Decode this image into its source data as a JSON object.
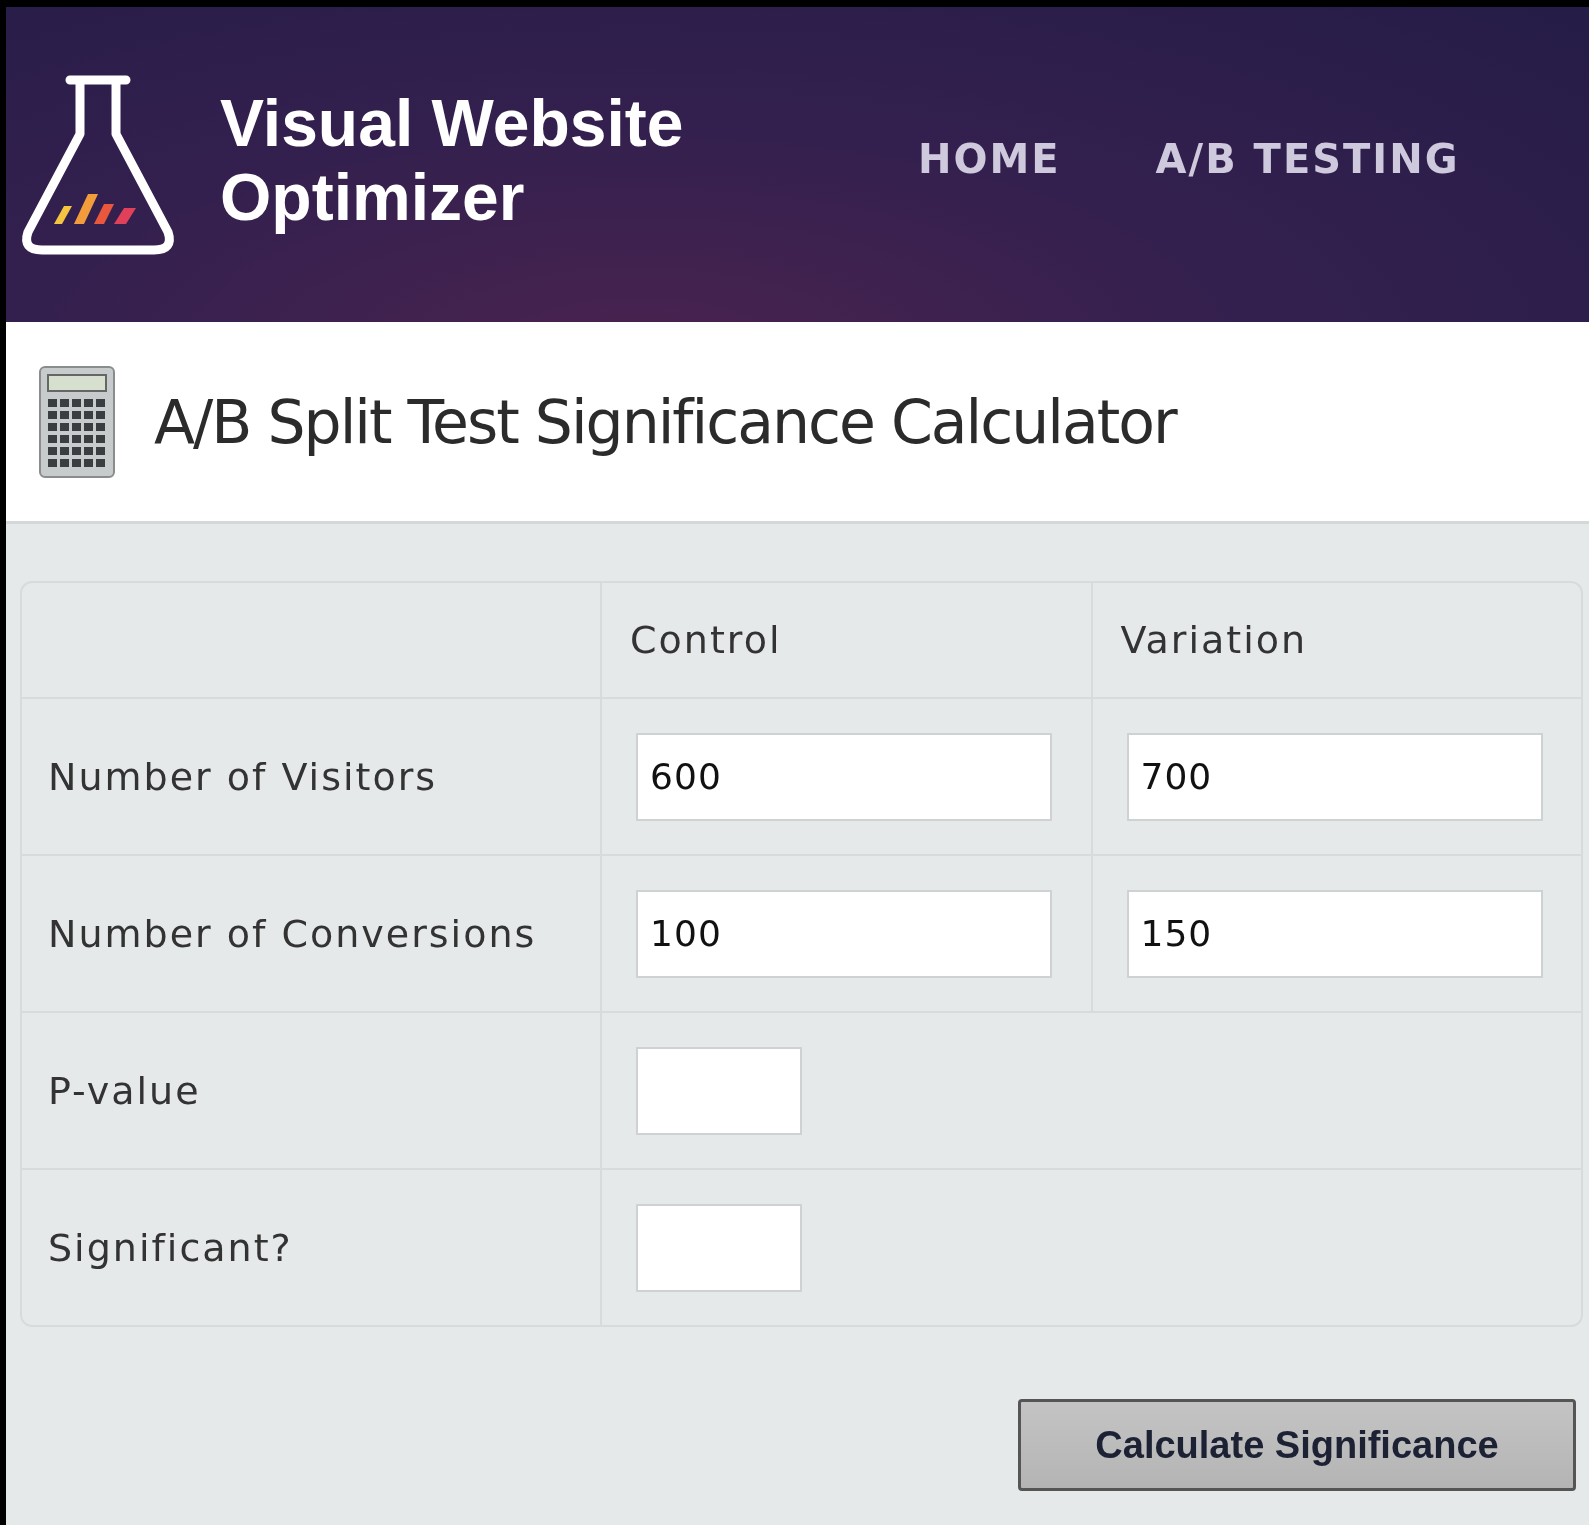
{
  "header": {
    "logo_text": "Visual Website Optimizer",
    "nav": [
      {
        "label": "HOME"
      },
      {
        "label": "A/B TESTING"
      }
    ]
  },
  "page_title": "A/B Split Test Significance Calculator",
  "table": {
    "columns": [
      "Control",
      "Variation"
    ],
    "rows": [
      {
        "label": "Number of Visitors",
        "kind": "pair",
        "values": [
          "600",
          "700"
        ]
      },
      {
        "label": "Number of Conversions",
        "kind": "pair",
        "values": [
          "100",
          "150"
        ]
      },
      {
        "label": "P-value",
        "kind": "result"
      },
      {
        "label": "Significant?",
        "kind": "result"
      }
    ]
  },
  "button": "Calculate Significance"
}
